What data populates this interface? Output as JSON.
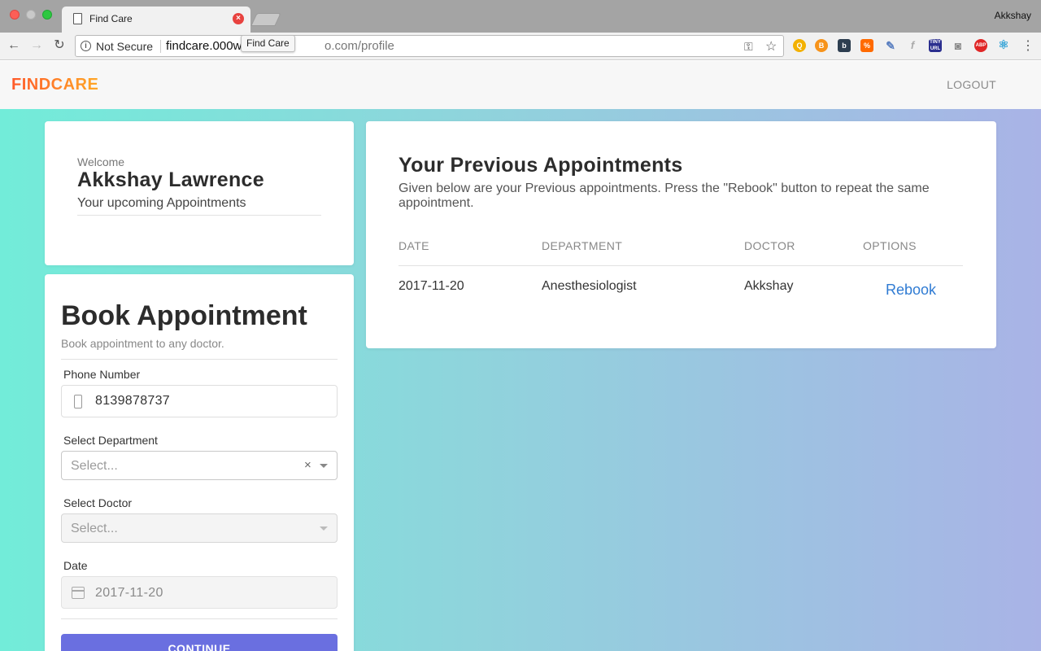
{
  "browser": {
    "tab_title": "Find Care",
    "tab_close_glyph": "×",
    "profile_name": "Akkshay",
    "security_label": "Not Secure",
    "url_host": "findcare.000w",
    "url_path": "o.com/profile",
    "tooltip": "Find Care",
    "icons": [
      "back-icon",
      "forward-icon",
      "reload-icon",
      "info-icon",
      "key-icon",
      "star-icon",
      "menu-icon"
    ],
    "extensions": [
      {
        "name": "ext-q-icon",
        "glyph": "Q"
      },
      {
        "name": "ext-bitcoin-icon",
        "glyph": "B"
      },
      {
        "name": "ext-b-icon",
        "glyph": "b"
      },
      {
        "name": "ext-percent-icon",
        "glyph": "%"
      },
      {
        "name": "ext-eyedropper-icon",
        "glyph": "✎"
      },
      {
        "name": "ext-fx-icon",
        "glyph": "f"
      },
      {
        "name": "ext-tinyurl-icon",
        "glyph": "TINY URL"
      },
      {
        "name": "ext-camera-icon",
        "glyph": "◙"
      },
      {
        "name": "ext-abp-icon",
        "glyph": "ABP"
      },
      {
        "name": "ext-react-icon",
        "glyph": "⚛"
      }
    ]
  },
  "header": {
    "logo": "FINDCARE",
    "logout_label": "LOGOUT"
  },
  "welcome": {
    "label": "Welcome",
    "name": "Akkshay Lawrence",
    "subtitle": "Your upcoming Appointments"
  },
  "booking": {
    "title": "Book Appointment",
    "subtitle": "Book appointment to any doctor.",
    "phone_label": "Phone Number",
    "phone_value": "8139878737",
    "department_label": "Select Department",
    "department_placeholder": "Select...",
    "clear_glyph": "×",
    "doctor_label": "Select Doctor",
    "doctor_placeholder": "Select...",
    "date_label": "Date",
    "date_value": "2017-11-20",
    "continue_label": "CONTINUE"
  },
  "previous": {
    "title": "Your Previous Appointments",
    "description": "Given below are your Previous appointments. Press the \"Rebook\" button to repeat the same appointment.",
    "columns": [
      "DATE",
      "DEPARTMENT",
      "DOCTOR",
      "OPTIONS"
    ],
    "rows": [
      {
        "date": "2017-11-20",
        "department": "Anesthesiologist",
        "doctor": "Akkshay",
        "action": "Rebook"
      }
    ]
  },
  "colors": {
    "accent": "#6a6fe0",
    "link": "#2f7bd3",
    "logo_start": "#ff5a2a",
    "logo_end": "#ffa726",
    "bg_left": "#72ecd9",
    "bg_right": "#a9b3e6"
  }
}
